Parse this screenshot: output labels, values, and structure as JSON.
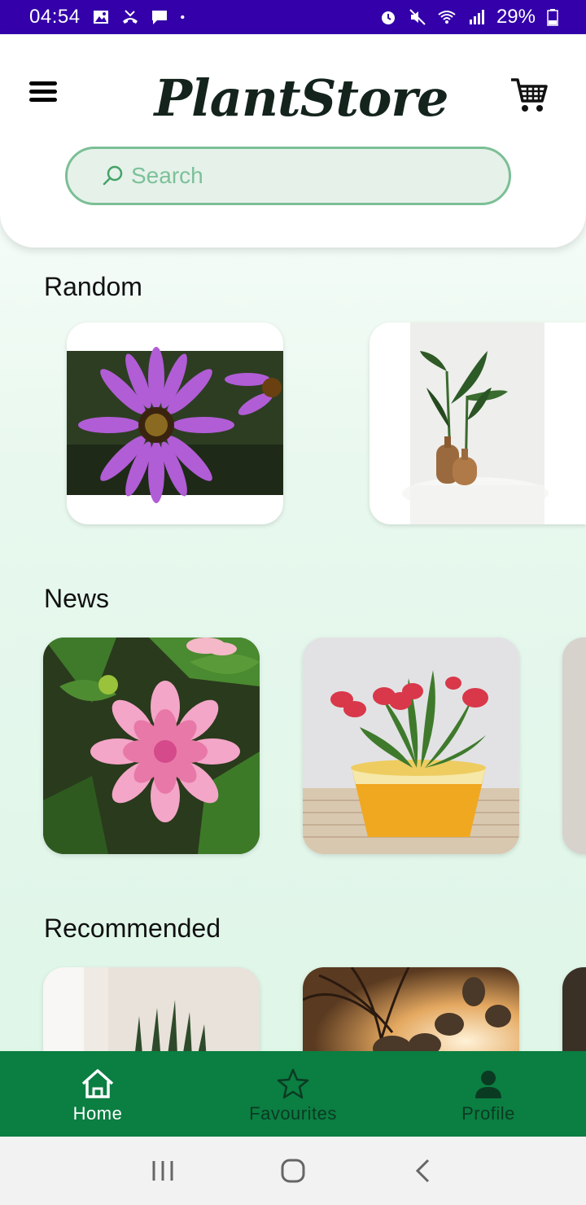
{
  "status_bar": {
    "time": "04:54",
    "battery": "29%",
    "left_icons": [
      "image-icon",
      "missed-call-icon",
      "message-icon",
      "dot-icon"
    ],
    "right_icons": [
      "alarm-icon",
      "mute-icon",
      "wifi-icon",
      "signal-icon",
      "battery-icon"
    ],
    "bg_color": "#3300aa"
  },
  "header": {
    "app_title": "PlantStore",
    "menu_icon": "menu-icon",
    "cart_icon": "cart-icon"
  },
  "search": {
    "placeholder": "Search",
    "value": ""
  },
  "sections": {
    "random": {
      "title": "Random",
      "cards": [
        {
          "image": "purple-daisy-flower"
        },
        {
          "image": "leafy-plant-in-wooden-vases"
        }
      ]
    },
    "news": {
      "title": "News",
      "cards": [
        {
          "image": "pink-dahlia-flower"
        },
        {
          "image": "red-tulips-in-yellow-pot"
        },
        {
          "image": "partial-card"
        }
      ]
    },
    "recommended": {
      "title": "Recommended",
      "cards": [
        {
          "image": "snake-plant"
        },
        {
          "image": "succulent-cactus-sunset"
        },
        {
          "image": "partial-card"
        }
      ]
    }
  },
  "bottom_nav": {
    "items": [
      {
        "label": "Home",
        "icon": "home-icon",
        "active": true
      },
      {
        "label": "Favourites",
        "icon": "star-icon",
        "active": false
      },
      {
        "label": "Profile",
        "icon": "person-icon",
        "active": false
      }
    ],
    "bg_color": "#0b7e42"
  },
  "system_nav": {
    "icons": [
      "recents-icon",
      "home-circle-icon",
      "back-icon"
    ]
  },
  "colors": {
    "accent": "#0b7e42",
    "search_border": "#7bbf95",
    "search_bg": "#e6f1ea"
  }
}
